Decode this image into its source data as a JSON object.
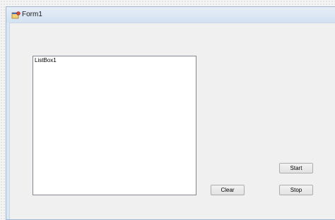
{
  "window": {
    "title": "Form1",
    "icon": "form-app-icon"
  },
  "listbox": {
    "items": [
      "ListBox1"
    ]
  },
  "buttons": {
    "start_label": "Start",
    "clear_label": "Clear",
    "stop_label": "Stop"
  },
  "colors": {
    "title_bar": "#d3e1f1",
    "client_area": "#f0f0f0",
    "listbox_background": "#ffffff",
    "button_face": "#e6e6e6"
  }
}
